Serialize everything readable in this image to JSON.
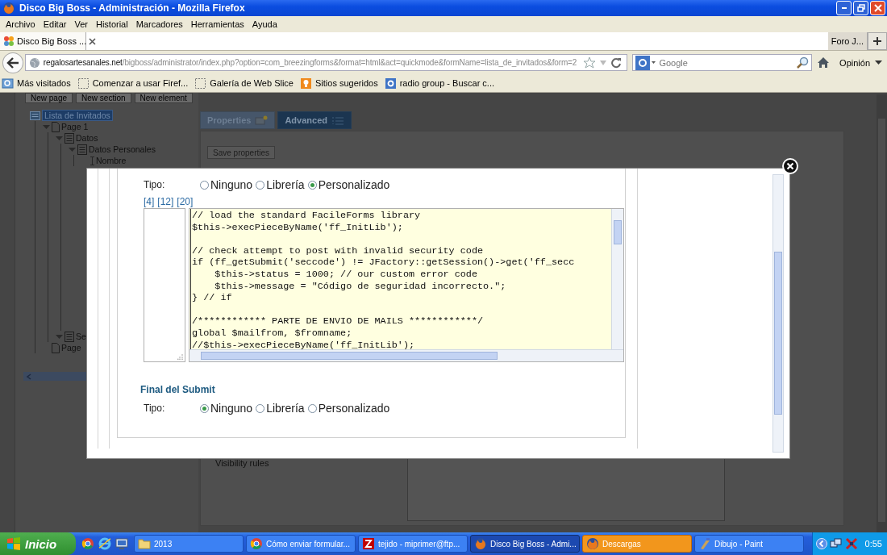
{
  "window": {
    "title": "Disco Big Boss - Administración - Mozilla Firefox"
  },
  "menu": [
    "Archivo",
    "Editar",
    "Ver",
    "Historial",
    "Marcadores",
    "Herramientas",
    "Ayuda"
  ],
  "tabs": [
    {
      "label": "Disco Big Boss ...",
      "selected": true
    },
    {
      "label": "Foro J...",
      "selected": false
    }
  ],
  "address": {
    "url": "**regalosartesanales.net**/bigboss/administrator/index.php?option=com_breezingforms&format=html&act=quickmode&formName=lista_de_invitados&form=2"
  },
  "search": {
    "placeholder": "Google"
  },
  "feedback": "Opinión",
  "bookmarks": [
    {
      "label": "Más visitados",
      "kind": "folder"
    },
    {
      "label": "Comenzar a usar Firef...",
      "kind": "blank"
    },
    {
      "label": "Galería de Web Slice",
      "kind": "blank"
    },
    {
      "label": "Sitios sugeridos",
      "kind": "suggested"
    },
    {
      "label": "radio group - Buscar c...",
      "kind": "google"
    }
  ],
  "toolbar_buttons": [
    "New page",
    "New section",
    "New element"
  ],
  "tree": [
    {
      "label": "Lista de Invitados",
      "kind": "form",
      "selected": true,
      "children": [
        {
          "label": "Page 1",
          "kind": "page",
          "selected": false,
          "expanded": true,
          "children": [
            {
              "label": "Datos",
              "kind": "section",
              "selected": false,
              "expanded": true,
              "children": [
                {
                  "label": "Datos Personales",
                  "kind": "section",
                  "selected": false,
                  "expanded": true,
                  "children": [
                    {
                      "label": "Nombre",
                      "kind": "element",
                      "selected": false
                    }
                  ]
                }
              ]
            },
            {
              "label": "Se",
              "kind": "section",
              "selected": false,
              "expanded": true
            }
          ]
        },
        {
          "label": "Page",
          "kind": "page",
          "selected": false
        }
      ]
    }
  ],
  "panel_tabs": [
    {
      "label": "Properties",
      "selected": false
    },
    {
      "label": "Advanced",
      "selected": true
    }
  ],
  "save_button": "Save properties",
  "visibility_label": "Visibility rules",
  "dialog": {
    "script_type": {
      "label": "Tipo:",
      "options": [
        {
          "label": "Ninguno",
          "selected": false
        },
        {
          "label": "Librería",
          "selected": false
        },
        {
          "label": "Personalizado",
          "selected": true
        }
      ]
    },
    "indent_links": [
      "[4]",
      "[12]",
      "[20]"
    ],
    "code": "// load the standard FacileForms library\n$this->execPieceByName('ff_InitLib');\n\n// check attempt to post with invalid security code\nif (ff_getSubmit('seccode') != JFactory::getSession()->get('ff_secc\n    $this->status = 1000; // our custom error code\n    $this->message = \"Código de seguridad incorrecto.\";\n} // if\n\n/************ PARTE DE ENVIO DE MAILS ************/\nglobal $mailfrom, $fromname;\n//$this->execPieceByName('ff_InitLib');",
    "final_heading": "Final del Submit",
    "final_type": {
      "label": "Tipo:",
      "options": [
        {
          "label": "Ninguno",
          "selected": true
        },
        {
          "label": "Librería",
          "selected": false
        },
        {
          "label": "Personalizado",
          "selected": false
        }
      ]
    }
  },
  "taskbar": {
    "start": "Inicio",
    "items": [
      {
        "label": "2013",
        "kind": "folder",
        "selected": false,
        "flashing": false
      },
      {
        "label": "Cómo enviar formular...",
        "kind": "chrome",
        "selected": false,
        "flashing": false
      },
      {
        "label": "tejido - miprimer@ftp...",
        "kind": "filezilla",
        "selected": false,
        "flashing": false
      },
      {
        "label": "Disco Big Boss - Admi...",
        "kind": "firefox",
        "selected": true,
        "flashing": false
      },
      {
        "label": "Descargas",
        "kind": "firefox",
        "selected": false,
        "flashing": true
      },
      {
        "label": "Dibujo - Paint",
        "kind": "paint",
        "selected": false,
        "flashing": false
      }
    ],
    "clock": "0:55"
  }
}
